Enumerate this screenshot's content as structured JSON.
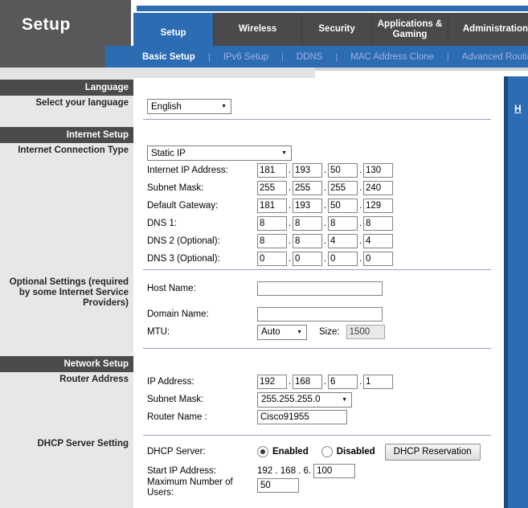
{
  "colors": {
    "accent_blue": "#2b6cb3",
    "header_gray": "#58585a",
    "tab_gray": "#4a4a4c",
    "sidebar_bg": "#e7e7e7",
    "section_bar": "#4b4b4d",
    "divider": "#9c9cc2"
  },
  "icons": {
    "dropdown_arrow": "▼"
  },
  "header": {
    "page_title": "Setup",
    "tabs": [
      {
        "label": "Setup"
      },
      {
        "label": "Wireless"
      },
      {
        "label": "Security"
      },
      {
        "label": "Applications & Gaming"
      },
      {
        "label": "Administration"
      }
    ],
    "subnav": {
      "separator": "|",
      "items": [
        {
          "label": "Basic Setup"
        },
        {
          "label": "IPv6 Setup"
        },
        {
          "label": "DDNS"
        },
        {
          "label": "MAC Address Clone"
        },
        {
          "label": "Advanced Routing"
        }
      ]
    }
  },
  "help": {
    "link_text": "H"
  },
  "sidebar": {
    "section_language": "Language",
    "section_internet": "Internet Setup",
    "section_network": "Network Setup",
    "select_language": "Select your language",
    "connection_type": "Internet Connection Type",
    "optional_settings": "Optional Settings (required by some Internet Service Providers)",
    "router_address": "Router Address",
    "dhcp_setting": "DHCP Server Setting"
  },
  "main": {
    "octet_separator": ".",
    "language": {
      "selected": "English"
    },
    "internet": {
      "connection_type": "Static IP",
      "rows": [
        {
          "label": "Internet IP Address:",
          "octets": [
            "181",
            "193",
            "50",
            "130"
          ]
        },
        {
          "label": "Subnet Mask:",
          "octets": [
            "255",
            "255",
            "255",
            "240"
          ]
        },
        {
          "label": "Default Gateway:",
          "octets": [
            "181",
            "193",
            "50",
            "129"
          ]
        },
        {
          "label": "DNS 1:",
          "octets": [
            "8",
            "8",
            "8",
            "8"
          ]
        },
        {
          "label": "DNS 2 (Optional):",
          "octets": [
            "8",
            "8",
            "4",
            "4"
          ]
        },
        {
          "label": "DNS 3 (Optional):",
          "octets": [
            "0",
            "0",
            "0",
            "0"
          ]
        }
      ]
    },
    "optional": {
      "host_label": "Host Name:",
      "host_value": "",
      "domain_label": "Domain Name:",
      "domain_value": "",
      "mtu_label": "MTU:",
      "mtu_selected": "Auto",
      "size_label": "Size:",
      "size_value": "1500"
    },
    "network": {
      "ip_label": "IP Address:",
      "ip_octets": [
        "192",
        "168",
        "6",
        "1"
      ],
      "subnet_label": "Subnet Mask:",
      "subnet_selected": "255.255.255.0",
      "router_name_label": "Router Name :",
      "router_name_value": "Cisco91955"
    },
    "dhcp": {
      "server_label": "DHCP Server:",
      "enabled_label": "Enabled",
      "disabled_label": "Disabled",
      "reservation_button": "DHCP Reservation",
      "start_ip_label": "Start IP Address:",
      "start_ip_prefix": "192 . 168 . 6.",
      "start_ip_value": "100",
      "max_users_label": "Maximum Number of Users:",
      "max_users_value": "50"
    }
  }
}
